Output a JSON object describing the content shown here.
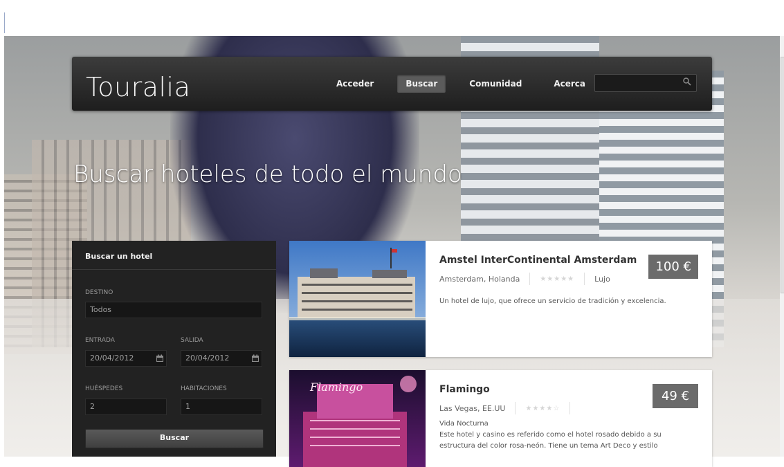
{
  "header": {
    "brand": "Touralia",
    "nav": [
      {
        "label": "Acceder",
        "active": false
      },
      {
        "label": "Buscar",
        "active": true
      },
      {
        "label": "Comunidad",
        "active": false
      },
      {
        "label": "Acerca",
        "active": false
      }
    ],
    "search_value": ""
  },
  "hero": {
    "title": "Buscar hoteles de todo el mundo"
  },
  "search_panel": {
    "title": "Buscar un hotel",
    "destino_label": "DESTINO",
    "destino_value": "Todos",
    "entrada_label": "ENTRADA",
    "entrada_value": "20/04/2012",
    "salida_label": "SALIDA",
    "salida_value": "20/04/2012",
    "huespedes_label": "HUÉSPEDES",
    "huespedes_value": "2",
    "habitaciones_label": "HABITACIONES",
    "habitaciones_value": "1",
    "button_label": "Buscar"
  },
  "results": [
    {
      "name": "Amstel InterContinental Amsterdam",
      "location": "Amsterdam, Holanda",
      "stars": 5,
      "category": "Lujo",
      "price": "100 €",
      "description": "Un hotel de lujo, que ofrece un servicio de tradición y excelencia."
    },
    {
      "name": "Flamingo",
      "location": "Las Vegas, EE.UU",
      "stars": 4,
      "category": "Vida Nocturna",
      "price": "49 €",
      "description": "Este hotel y casino es referido como el hotel rosado debido a su estructura del color rosa-neón. Tiene un tema Art Deco y estilo"
    }
  ],
  "colors": {
    "header_bg": "#2b2b2b",
    "panel_bg": "#222222",
    "price_bg": "#6b6b6b"
  }
}
